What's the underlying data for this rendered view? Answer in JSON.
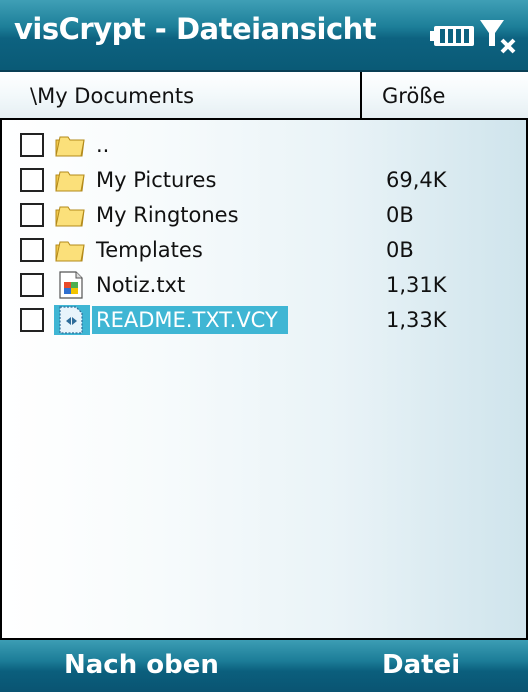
{
  "window": {
    "title": "visCrypt - Dateiansicht"
  },
  "header": {
    "path": "\\My Documents",
    "size_col": "Größe"
  },
  "files": [
    {
      "name": "..",
      "size": "",
      "icon": "folder-icon"
    },
    {
      "name": "My Pictures",
      "size": "69,4K",
      "icon": "folder-icon"
    },
    {
      "name": "My Ringtones",
      "size": "0B",
      "icon": "folder-icon"
    },
    {
      "name": "Templates",
      "size": "0B",
      "icon": "folder-icon"
    },
    {
      "name": "Notiz.txt",
      "size": "1,31K",
      "icon": "text-file-icon"
    },
    {
      "name": "README.TXT.VCY",
      "size": "1,33K",
      "icon": "encrypted-file-icon",
      "selected": true
    }
  ],
  "softkeys": {
    "left": "Nach oben",
    "right": "Datei"
  },
  "colors": {
    "accent": "#1d7f99",
    "selection": "#3fb6d4",
    "folder": "#f2c94c"
  }
}
